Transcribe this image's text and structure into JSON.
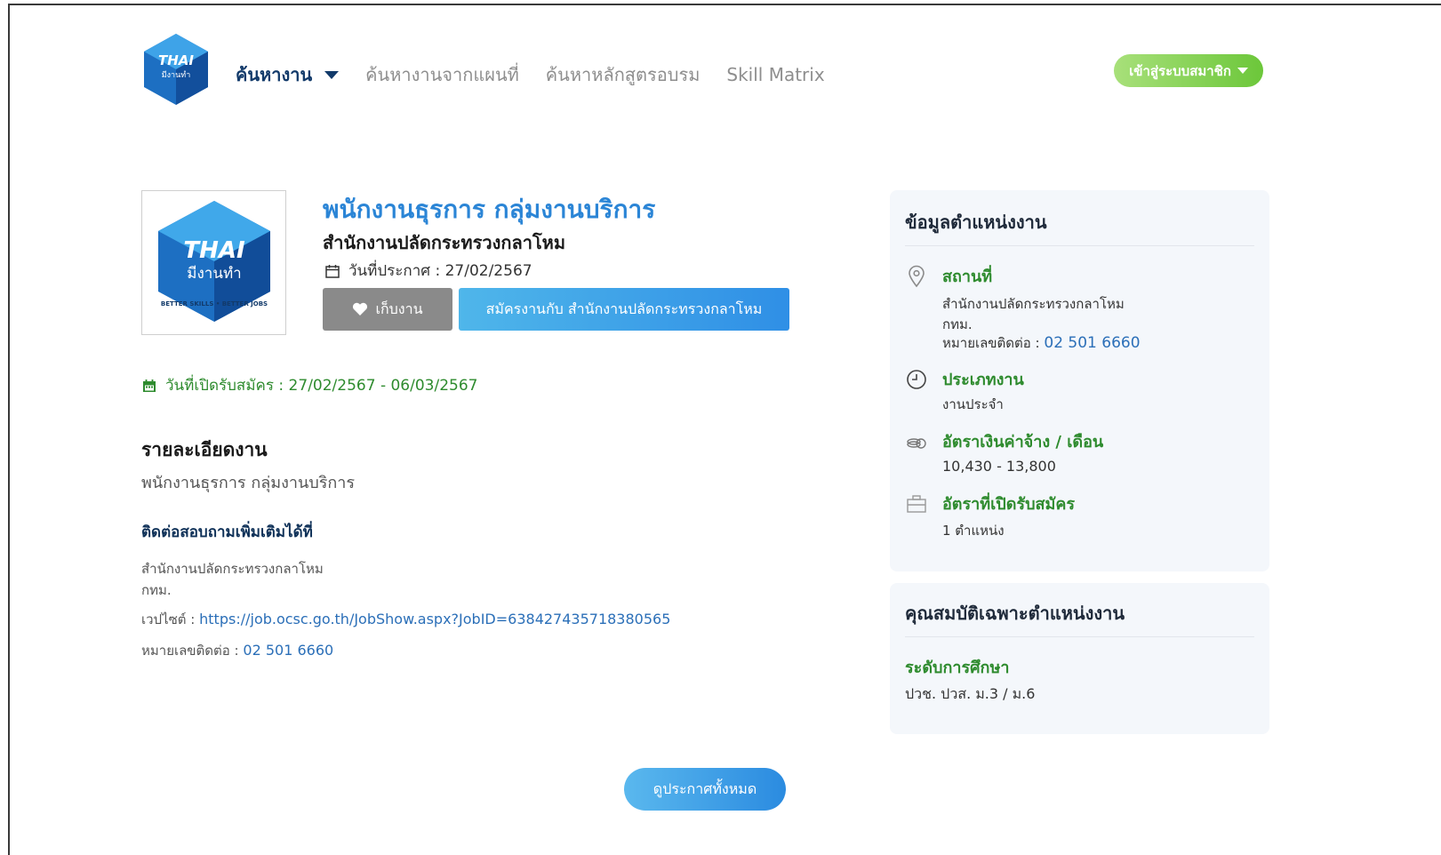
{
  "header": {
    "logo": {
      "line1": "THAI",
      "line2": "มีงานทำ",
      "ring": "BETTER SKILLS • BETTER JOBS"
    },
    "nav": [
      {
        "label": "ค้นหางาน"
      },
      {
        "label": "ค้นหางานจากแผนที่"
      },
      {
        "label": "ค้นหาหลักสูตรอบรม"
      },
      {
        "label": "Skill Matrix"
      }
    ],
    "member_button": "เข้าสู่ระบบสมาชิก"
  },
  "job": {
    "title": "พนักงานธุรการ กลุ่มงานบริการ",
    "company": "สำนักงานปลัดกระทรวงกลาโหม",
    "announce_date": "วันที่ประกาศ : 27/02/2567",
    "save_button": "เก็บงาน",
    "apply_button": "สมัครงานกับ สำนักงานปลัดกระทรวงกลาโหม",
    "open_period": "วันที่เปิดรับสมัคร : 27/02/2567 - 06/03/2567",
    "detail_heading": "รายละเอียดงาน",
    "detail_text": "พนักงานธุรการ กลุ่มงานบริการ",
    "contact_heading": "ติดต่อสอบถามเพิ่มเติมได้ที่",
    "contact_org": "สำนักงานปลัดกระทรวงกลาโหม",
    "contact_province": "กทม.",
    "website_label": "เวปไซต์ : ",
    "website_url": "https://job.ocsc.go.th/JobShow.aspx?JobID=638427435718380565",
    "phone_label": "หมายเลขติดต่อ : ",
    "phone": "02 501 6660"
  },
  "position_info": {
    "heading": "ข้อมูลตำแหน่งงาน",
    "location_label": "สถานที่",
    "location_org": "สำนักงานปลัดกระทรวงกลาโหม",
    "location_province": "กทม.",
    "phone_label": "หมายเลขติดต่อ : ",
    "phone": "02 501 6660",
    "type_label": "ประเภทงาน",
    "type_value": "งานประจำ",
    "salary_label": "อัตราเงินค่าจ้าง / เดือน",
    "salary_value": "10,430 - 13,800",
    "vacancy_label": "อัตราที่เปิดรับสมัคร",
    "vacancy_value": "1 ตำแหน่ง"
  },
  "qualification": {
    "heading": "คุณสมบัติเฉพาะตำแหน่งงาน",
    "edu_label": "ระดับการศึกษา",
    "edu_value": "ปวช. ปวส. ม.3 / ม.6"
  },
  "view_all_button": "ดูประกาศทั้งหมด",
  "colors": {
    "title_blue": "#2b85d6",
    "green": "#2e8b2e",
    "navy": "#123a6a",
    "member_green": "#6cc73a"
  }
}
